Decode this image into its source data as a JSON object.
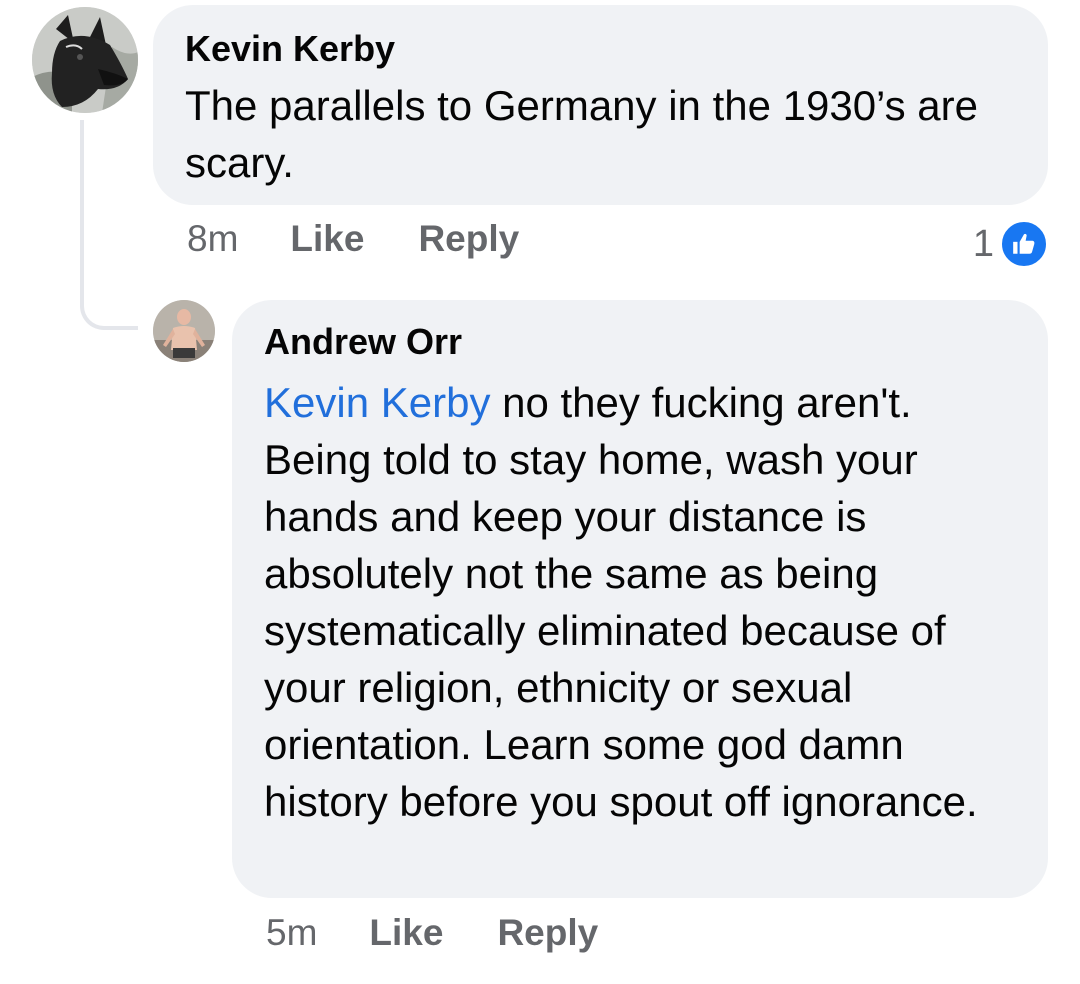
{
  "comments": [
    {
      "author": "Kevin Kerby",
      "avatar": "dog-avatar",
      "text": "The parallels to Germany in the 1930’s are scary.",
      "time": "8m",
      "like_label": "Like",
      "reply_label": "Reply",
      "reaction_count": "1",
      "reaction_icon": "thumbs-up-icon"
    },
    {
      "author": "Andrew Orr",
      "avatar": "person-avatar",
      "mention": "Kevin Kerby",
      "text": " no they fucking aren't. Being told to stay home, wash your hands and keep your distance is absolutely not the same as being systematically eliminated because of your religion, ethnicity or sexual orientation. Learn some god damn history before you spout off ignorance.",
      "time": "5m",
      "like_label": "Like",
      "reply_label": "Reply"
    }
  ],
  "colors": {
    "bubble": "#f0f2f5",
    "mention": "#216fdb",
    "secondary_text": "#65676b",
    "like_badge": "#1877f2",
    "thread_line": "#e4e6eb"
  }
}
